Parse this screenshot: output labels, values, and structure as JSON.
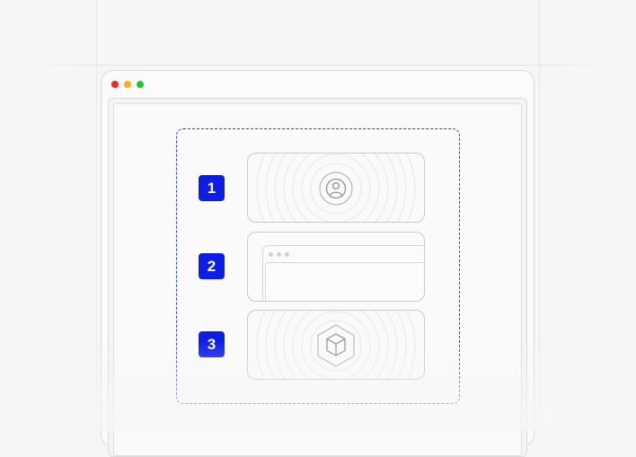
{
  "window": {
    "traffic_lights": {
      "close": "#f2271d",
      "minimize": "#f7b21e",
      "maximize": "#1fc832"
    }
  },
  "selection": {
    "border_color": "#2b3ee6",
    "style": "dashed"
  },
  "steps": [
    {
      "number": "1",
      "card": "user-avatar-icon"
    },
    {
      "number": "2",
      "card": "browser-window-icon"
    },
    {
      "number": "3",
      "card": "cube-icon"
    }
  ],
  "accent": "#0d1de8"
}
